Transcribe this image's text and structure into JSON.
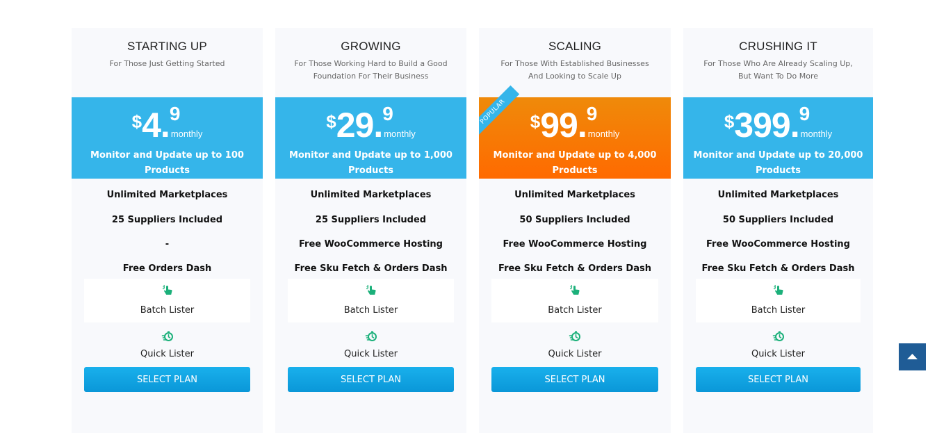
{
  "plans": [
    {
      "title": "STARTING UP",
      "subtitle": "For Those Just Getting Started",
      "currency": "$",
      "amount": "4.",
      "cents": "9",
      "period": "monthly",
      "description": "Monitor and Update up to 100 Products",
      "features": [
        "Unlimited Marketplaces",
        "25 Suppliers Included",
        "-",
        "Free Orders Dash"
      ],
      "tools": [
        {
          "label": "Batch Lister",
          "icon": "pointer-hand-icon"
        },
        {
          "label": "Quick Lister",
          "icon": "fast-timer-icon"
        }
      ],
      "cta": "SELECT PLAN",
      "popular": false
    },
    {
      "title": "GROWING",
      "subtitle": "For Those Working Hard to Build a Good Foundation For Their Business",
      "currency": "$",
      "amount": "29.",
      "cents": "9",
      "period": "monthly",
      "description": "Monitor and Update up to 1,000 Products",
      "features": [
        "Unlimited Marketplaces",
        "25 Suppliers Included",
        "Free WooCommerce Hosting",
        "Free Sku Fetch & Orders Dash"
      ],
      "tools": [
        {
          "label": "Batch Lister",
          "icon": "pointer-hand-icon"
        },
        {
          "label": "Quick Lister",
          "icon": "fast-timer-icon"
        }
      ],
      "cta": "SELECT PLAN",
      "popular": false
    },
    {
      "title": "SCALING",
      "subtitle": "For Those With Established Businesses And Looking to Scale Up",
      "currency": "$",
      "amount": "99.",
      "cents": "9",
      "period": "monthly",
      "description": "Monitor and Update up to 4,000 Products",
      "features": [
        "Unlimited Marketplaces",
        "50 Suppliers Included",
        "Free WooCommerce Hosting",
        "Free Sku Fetch & Orders Dash"
      ],
      "tools": [
        {
          "label": "Batch Lister",
          "icon": "pointer-hand-icon"
        },
        {
          "label": "Quick Lister",
          "icon": "fast-timer-icon"
        }
      ],
      "cta": "SELECT PLAN",
      "popular": true,
      "ribbon": "POPULAR"
    },
    {
      "title": "CRUSHING IT",
      "subtitle": "For Those Who Are Already Scaling Up, But Want To Do More",
      "currency": "$",
      "amount": "399.",
      "cents": "9",
      "period": "monthly",
      "description": "Monitor and Update up to 20,000 Products",
      "features": [
        "Unlimited Marketplaces",
        "50 Suppliers Included",
        "Free WooCommerce Hosting",
        "Free Sku Fetch & Orders Dash"
      ],
      "tools": [
        {
          "label": "Batch Lister",
          "icon": "pointer-hand-icon"
        },
        {
          "label": "Quick Lister",
          "icon": "fast-timer-icon"
        }
      ],
      "cta": "SELECT PLAN",
      "popular": false
    }
  ],
  "colors": {
    "band": "#35b5ea",
    "popular_band": "#ff7200",
    "button": "#0fa4e2",
    "icon": "#1bb07a",
    "scroll_top": "#1f5c96"
  },
  "scroll_top": {
    "icon": "arrow-up-icon"
  }
}
